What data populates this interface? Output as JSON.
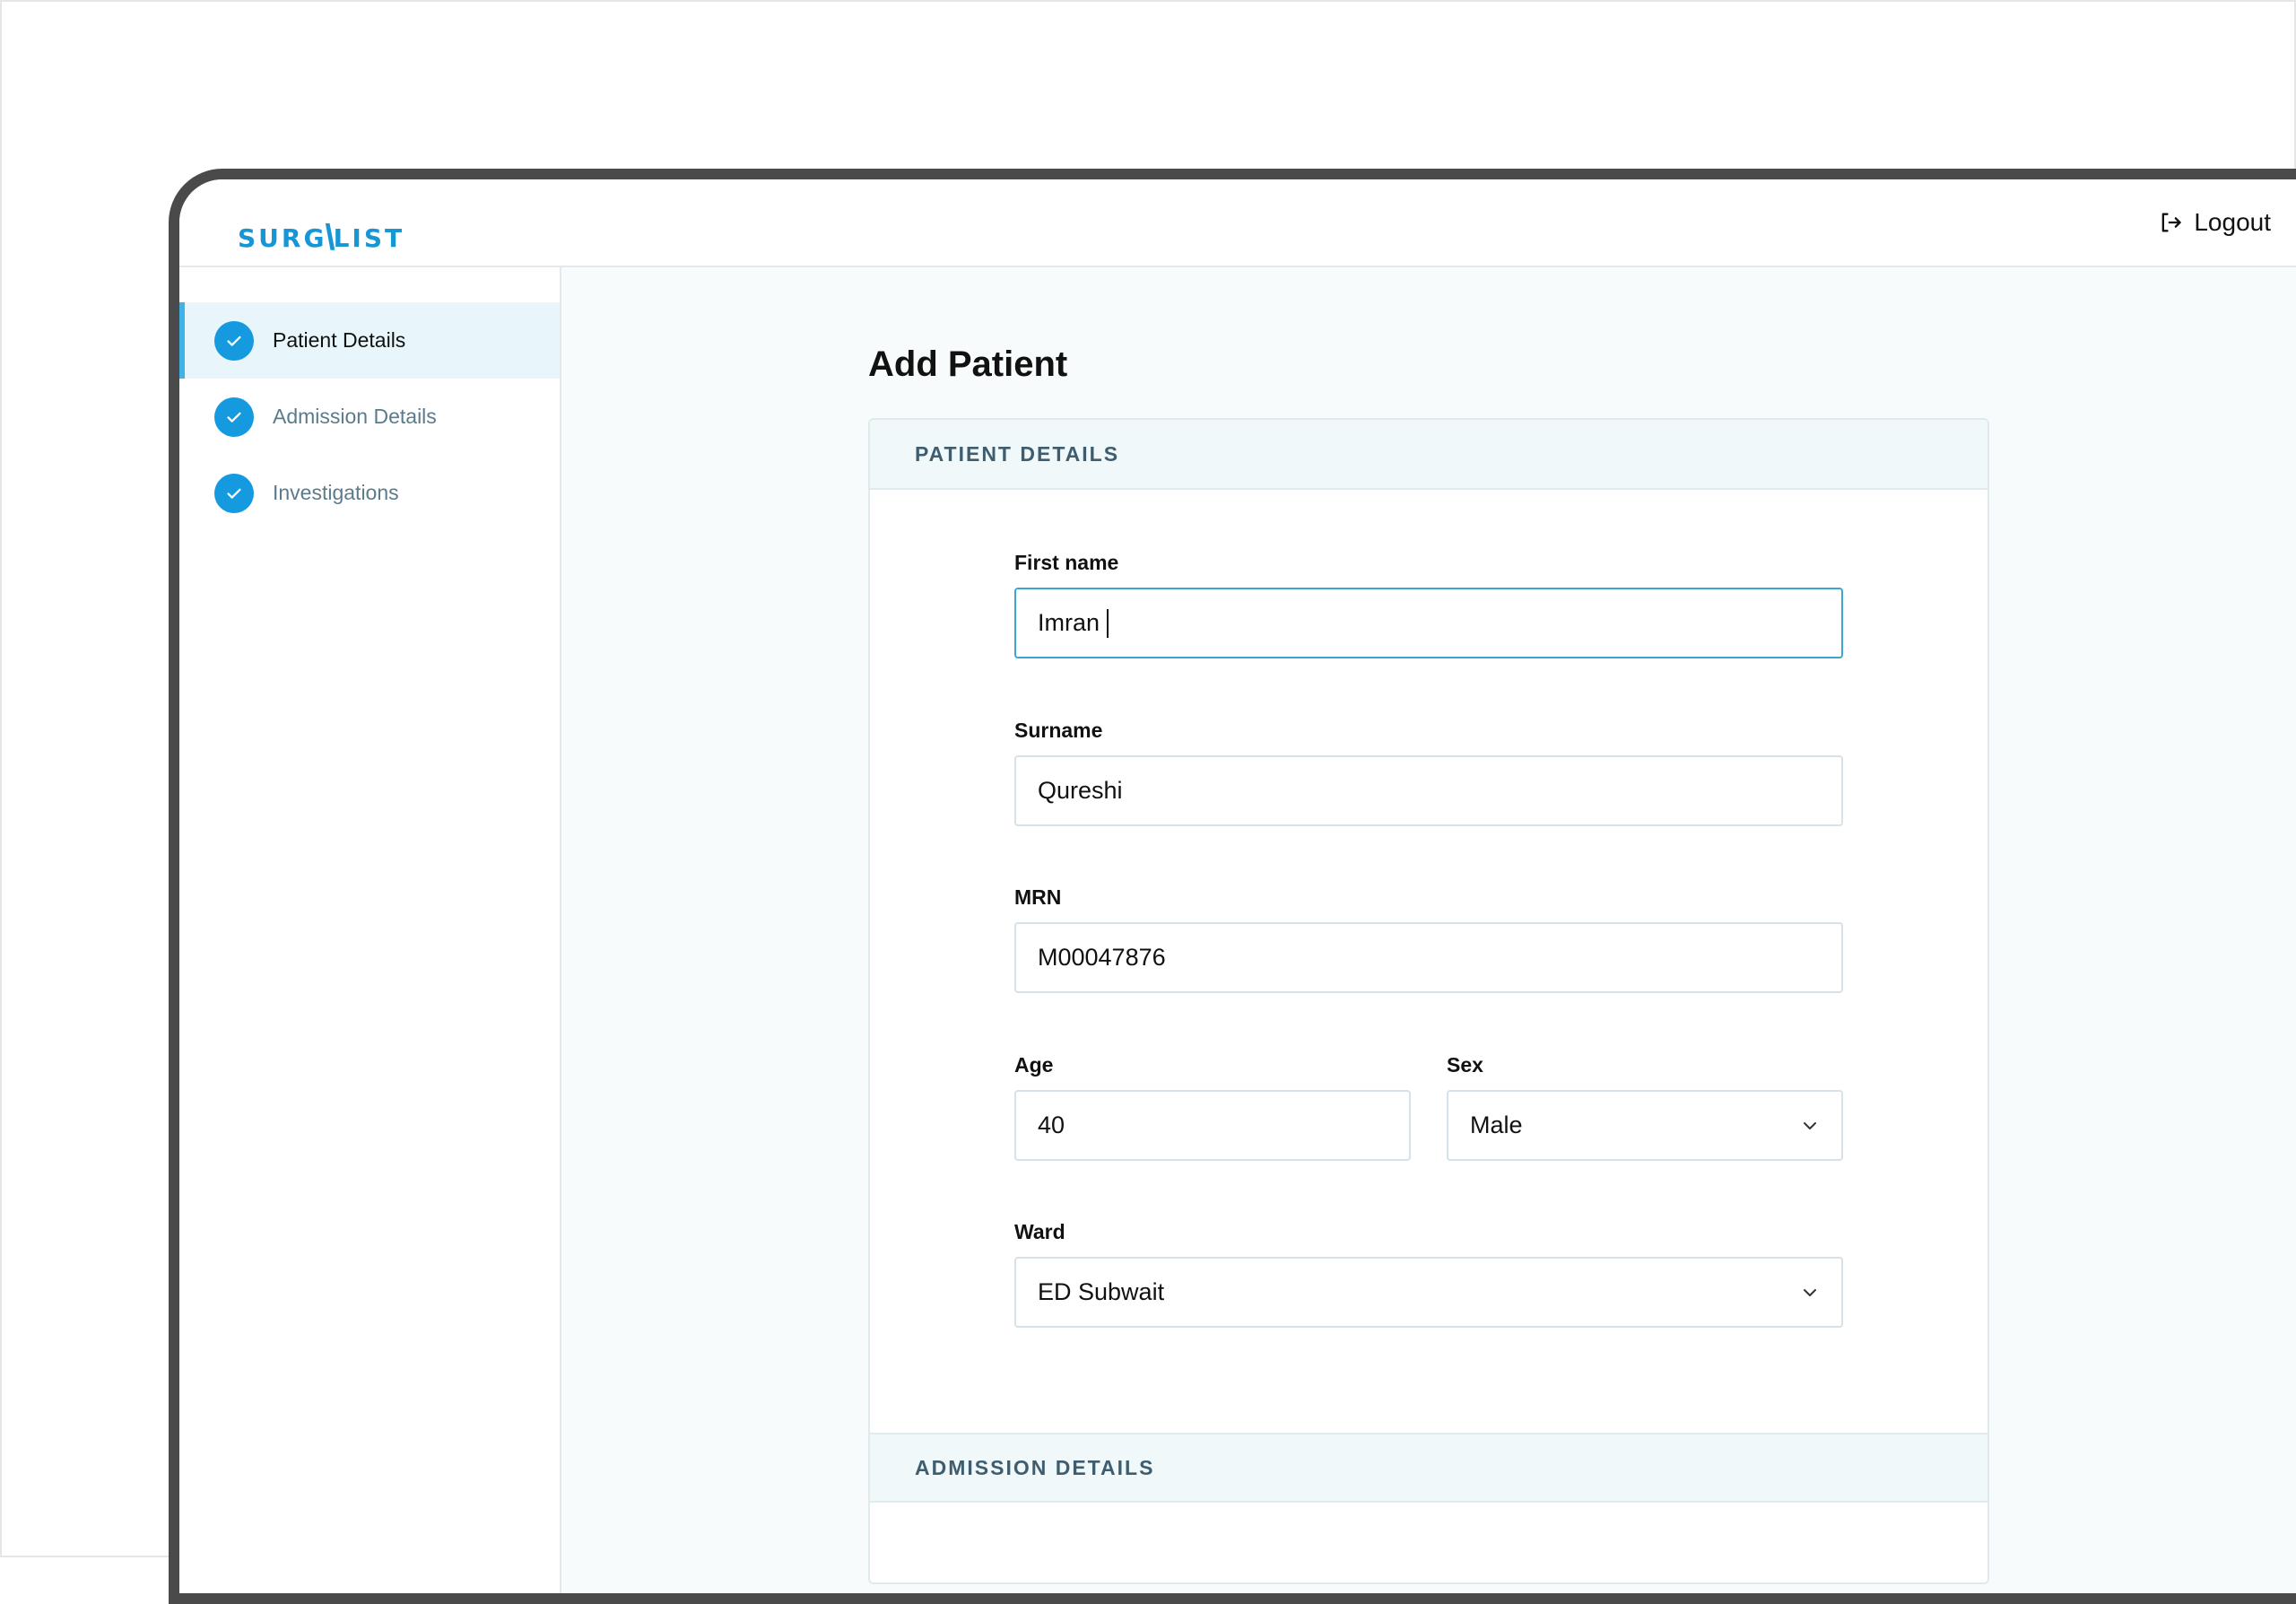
{
  "header": {
    "logo_left": "SURG",
    "logo_right": "LIST",
    "logout_label": "Logout"
  },
  "sidebar": {
    "steps": [
      {
        "label": "Patient Details",
        "active": true
      },
      {
        "label": "Admission Details",
        "active": false
      },
      {
        "label": "Investigations",
        "active": false
      }
    ]
  },
  "main": {
    "title": "Add Patient",
    "sections": {
      "patient": "PATIENT DETAILS",
      "admission": "ADMISSION DETAILS"
    },
    "fields": {
      "first_name": {
        "label": "First name",
        "value": "Imran"
      },
      "surname": {
        "label": "Surname",
        "value": "Qureshi"
      },
      "mrn": {
        "label": "MRN",
        "value": "M00047876"
      },
      "age": {
        "label": "Age",
        "value": "40"
      },
      "sex": {
        "label": "Sex",
        "value": "Male"
      },
      "ward": {
        "label": "Ward",
        "value": "ED Subwait"
      }
    }
  },
  "colors": {
    "accent": "#159ae0",
    "active_step_bg": "#e8f6fc",
    "focus_border": "#3ba6d3"
  }
}
